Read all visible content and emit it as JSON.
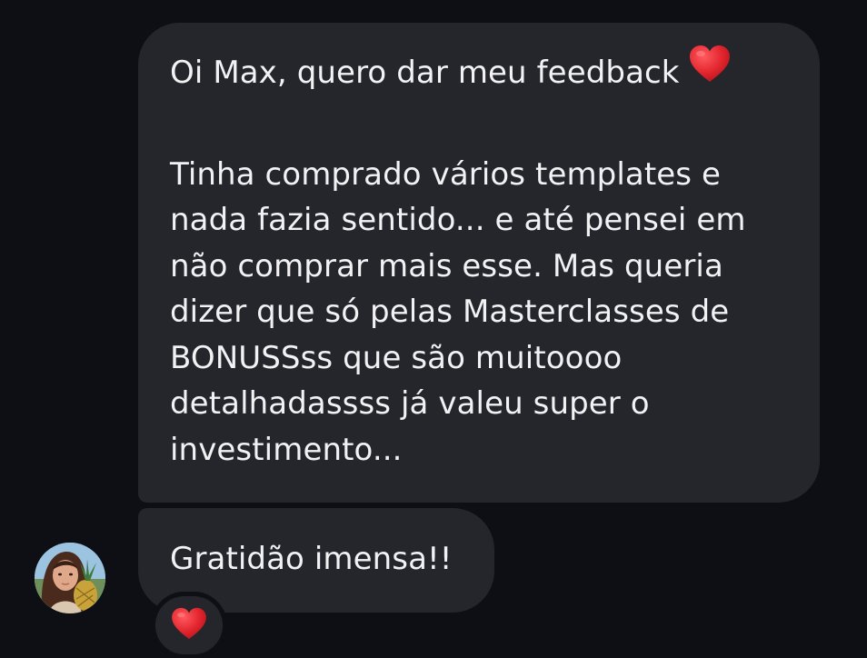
{
  "conversation": {
    "messages": [
      {
        "lines": [
          "Oi Max, quero dar meu feedback",
          "Tinha comprado vários templates e",
          "nada fazia sentido... e até pensei em",
          "não comprar mais esse. Mas queria",
          "dizer que só pelas Masterclasses de",
          "BONUSSss que são muitoooo",
          "detalhadassss já valeu super o",
          "investimento..."
        ],
        "emoji": "heart-emoji"
      },
      {
        "text": "Gratidão imensa!!"
      }
    ],
    "reaction": {
      "emoji": "heart-emoji"
    },
    "sender_avatar": "avatar"
  },
  "colors": {
    "background": "#0d0f14",
    "bubble": "#25262b",
    "text": "#f2f2f4",
    "heart": "#e3262f"
  }
}
